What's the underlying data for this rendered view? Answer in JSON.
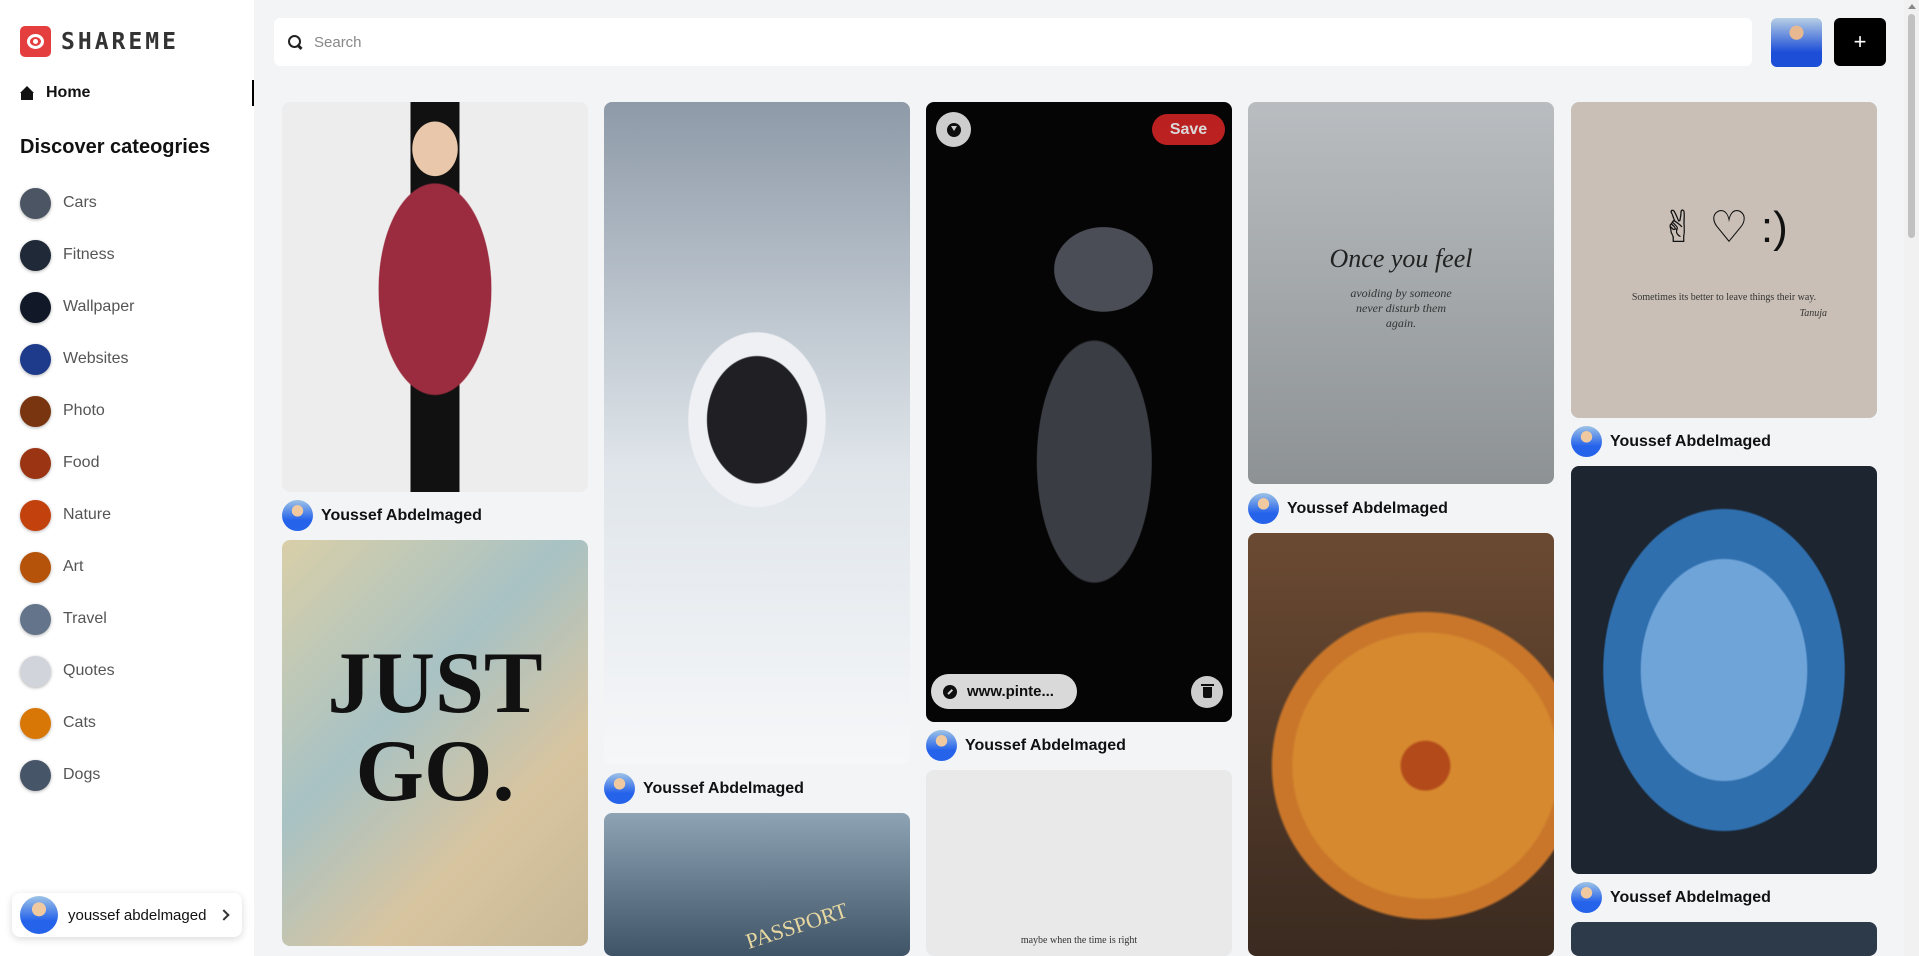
{
  "app": {
    "logo_text": "SHAREME",
    "brand_color": "#e53e3e"
  },
  "nav": {
    "home_label": "Home"
  },
  "categories": {
    "heading": "Discover cateogries",
    "items": [
      {
        "label": "Cars",
        "thumb_color": "#4b5563"
      },
      {
        "label": "Fitness",
        "thumb_color": "#1f2937"
      },
      {
        "label": "Wallpaper",
        "thumb_color": "#111827"
      },
      {
        "label": "Websites",
        "thumb_color": "#1e3a8a"
      },
      {
        "label": "Photo",
        "thumb_color": "#78350f"
      },
      {
        "label": "Food",
        "thumb_color": "#9a3412"
      },
      {
        "label": "Nature",
        "thumb_color": "#c2410c"
      },
      {
        "label": "Art",
        "thumb_color": "#b45309"
      },
      {
        "label": "Travel",
        "thumb_color": "#64748b"
      },
      {
        "label": "Quotes",
        "thumb_color": "#d1d5db"
      },
      {
        "label": "Cats",
        "thumb_color": "#d97706"
      },
      {
        "label": "Dogs",
        "thumb_color": "#475569"
      }
    ]
  },
  "user": {
    "name": "youssef abdelmaged"
  },
  "search": {
    "placeholder": "Search"
  },
  "topbar": {
    "add_label": "+"
  },
  "pins": {
    "author": "Youssef Abdelmaged",
    "justgo_text": "JUST GO.",
    "once_title": "Once you feel",
    "once_sub": "avoiding by someone never disturb them again.",
    "peace_icons": "✌ ♡ :)",
    "peace_caption": "Sometimes its better to leave things their way.",
    "peace_signature": "Tanuja",
    "passport_word": "PASSPORT",
    "quote_caption": "maybe when the time is right"
  },
  "active_pin": {
    "save_label": "Save",
    "link_label": "www.pinte..."
  }
}
